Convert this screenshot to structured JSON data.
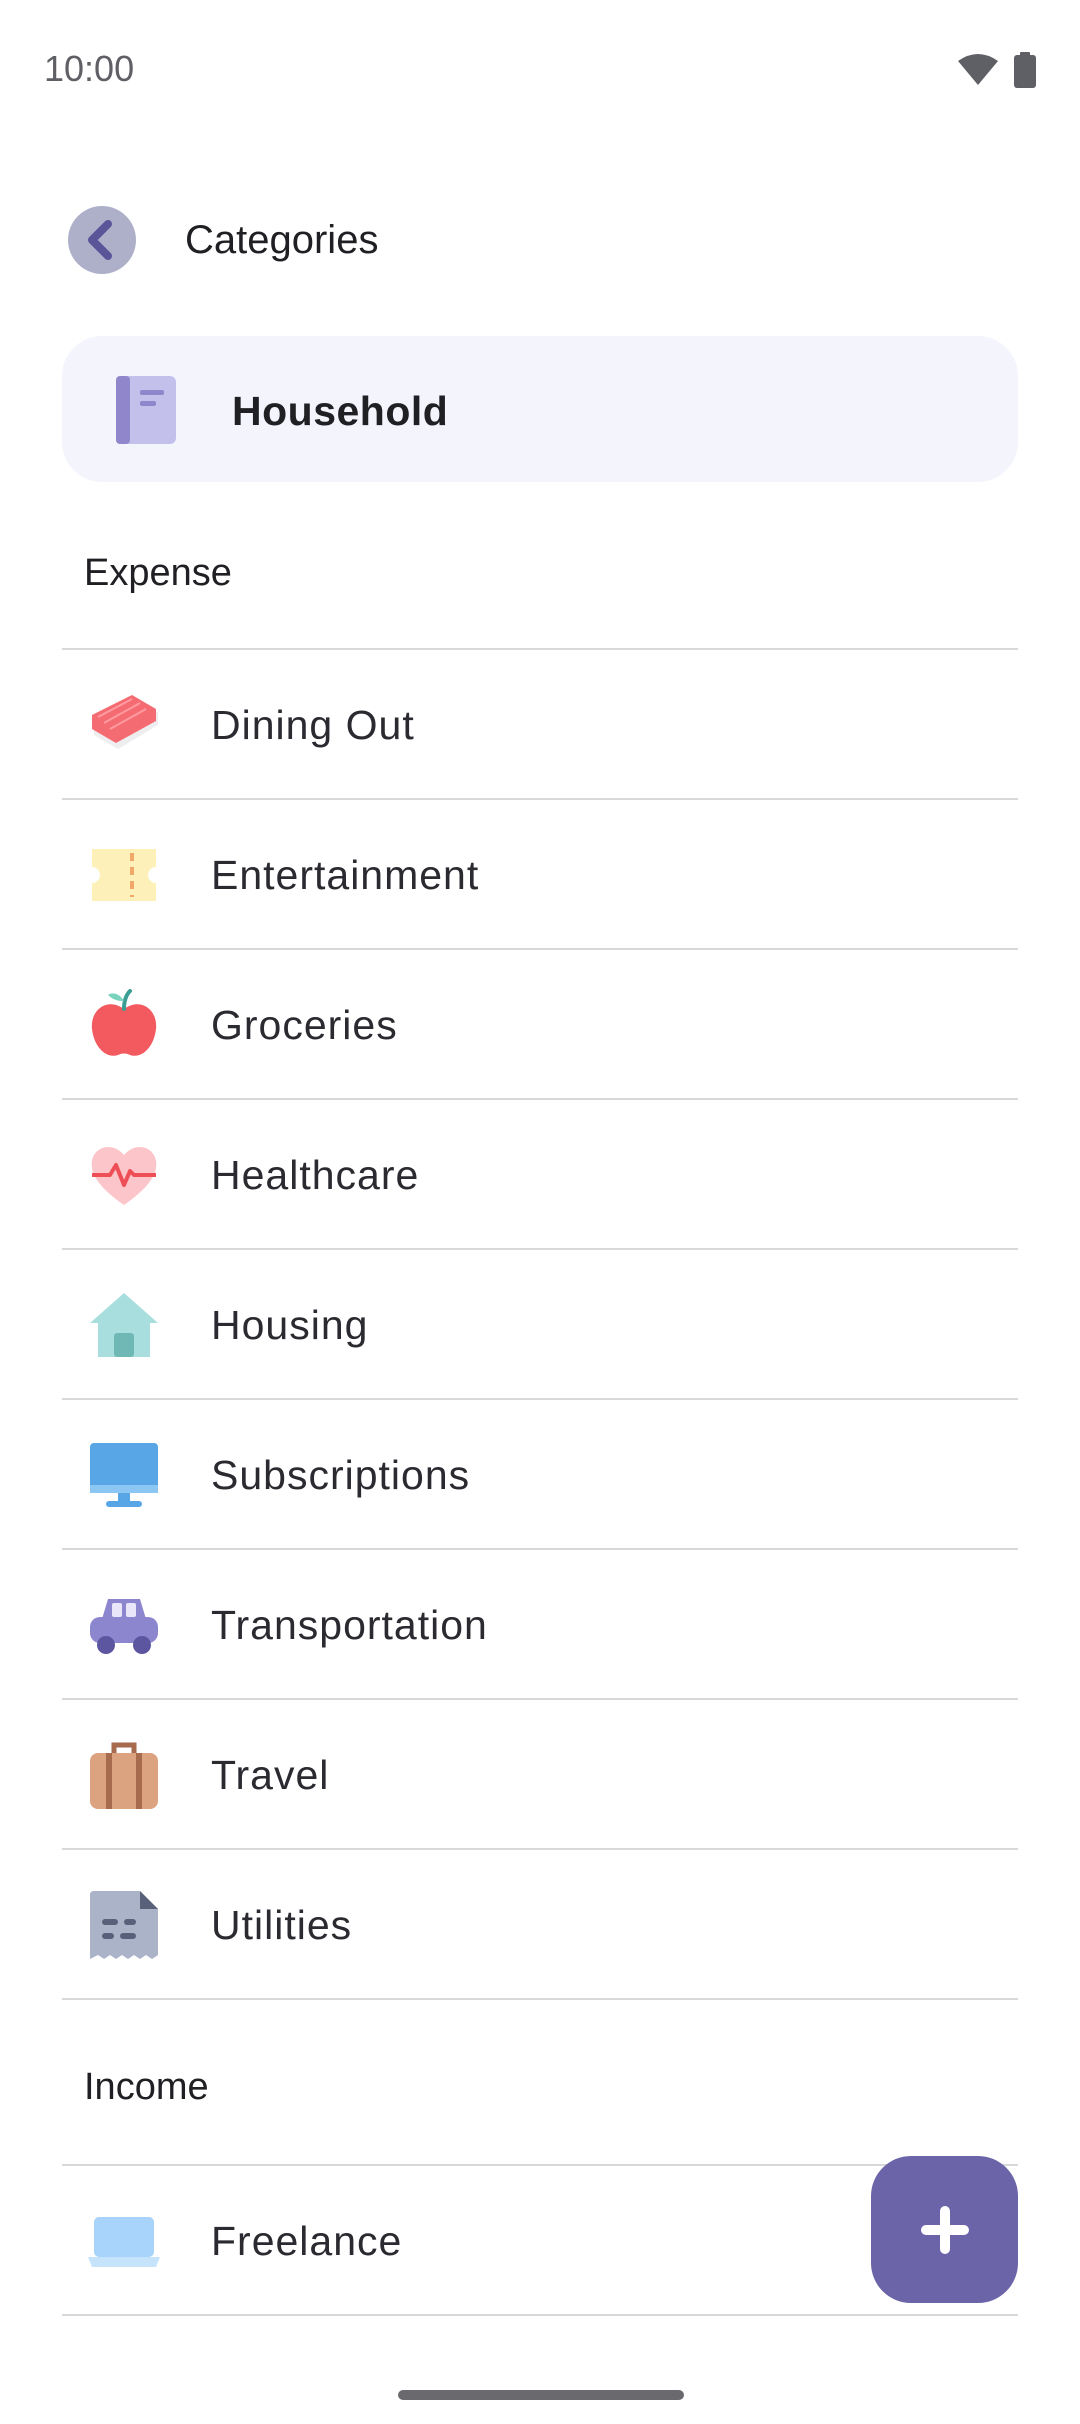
{
  "status_bar": {
    "time": "10:00",
    "wifi_icon": "wifi-icon",
    "battery_icon": "battery-icon"
  },
  "app_bar": {
    "back_icon": "chevron-left-icon",
    "title": "Categories"
  },
  "book": {
    "icon": "book-icon",
    "label": "Household"
  },
  "sections": {
    "expense": {
      "title": "Expense",
      "items": [
        {
          "label": "Dining Out",
          "icon": "sushi-icon"
        },
        {
          "label": "Entertainment",
          "icon": "ticket-icon"
        },
        {
          "label": "Groceries",
          "icon": "apple-icon"
        },
        {
          "label": "Healthcare",
          "icon": "heart-pulse-icon"
        },
        {
          "label": "Housing",
          "icon": "house-icon"
        },
        {
          "label": "Subscriptions",
          "icon": "monitor-icon"
        },
        {
          "label": "Transportation",
          "icon": "car-icon"
        },
        {
          "label": "Travel",
          "icon": "suitcase-icon"
        },
        {
          "label": "Utilities",
          "icon": "receipt-icon"
        }
      ]
    },
    "income": {
      "title": "Income",
      "items": [
        {
          "label": "Freelance",
          "icon": "laptop-icon"
        }
      ]
    }
  },
  "fab": {
    "icon": "plus-icon"
  },
  "colors": {
    "accent": "#6b64a8",
    "card_bg": "#f4f4fd",
    "divider": "#d9d9dc"
  }
}
